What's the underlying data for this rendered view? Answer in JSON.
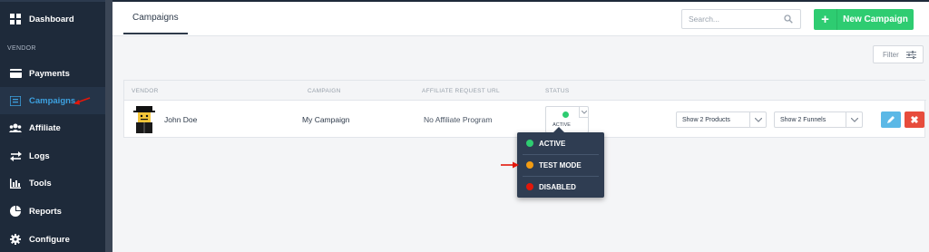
{
  "sidebar": {
    "section_label": "VENDOR",
    "items": [
      {
        "label": "Dashboard",
        "icon": "grid-icon"
      },
      {
        "label": "Payments",
        "icon": "card-icon"
      },
      {
        "label": "Campaigns",
        "icon": "list-icon"
      },
      {
        "label": "Affiliate",
        "icon": "users-icon"
      },
      {
        "label": "Logs",
        "icon": "exchange-icon"
      },
      {
        "label": "Tools",
        "icon": "bar-chart-icon"
      },
      {
        "label": "Reports",
        "icon": "pie-chart-icon"
      },
      {
        "label": "Configure",
        "icon": "gear-icon"
      }
    ]
  },
  "header": {
    "tab_label": "Campaigns",
    "search_placeholder": "Search...",
    "new_button_icon": "+",
    "new_button_label": "New Campaign"
  },
  "filter": {
    "label": "Filter"
  },
  "table": {
    "columns": [
      "VENDOR",
      "CAMPAIGN",
      "AFFILIATE REQUEST URL",
      "STATUS"
    ],
    "row": {
      "vendor": "John Doe",
      "campaign": "My Campaign",
      "affiliate_url": "No Affiliate Program",
      "status": "ACTIVE",
      "products_select": "Show 2 Products",
      "funnels_select": "Show 2 Funnels",
      "delete_icon": "✖"
    }
  },
  "status_menu": [
    {
      "label": "ACTIVE",
      "color": "#2ecc71"
    },
    {
      "label": "TEST MODE",
      "color": "#f39c12"
    },
    {
      "label": "DISABLED",
      "color": "#e3170a"
    }
  ],
  "colors": {
    "accent": "#3da1e0",
    "success": "#2ecc71",
    "danger": "#e74c3c",
    "annotation_arrow": "#e3170a"
  }
}
